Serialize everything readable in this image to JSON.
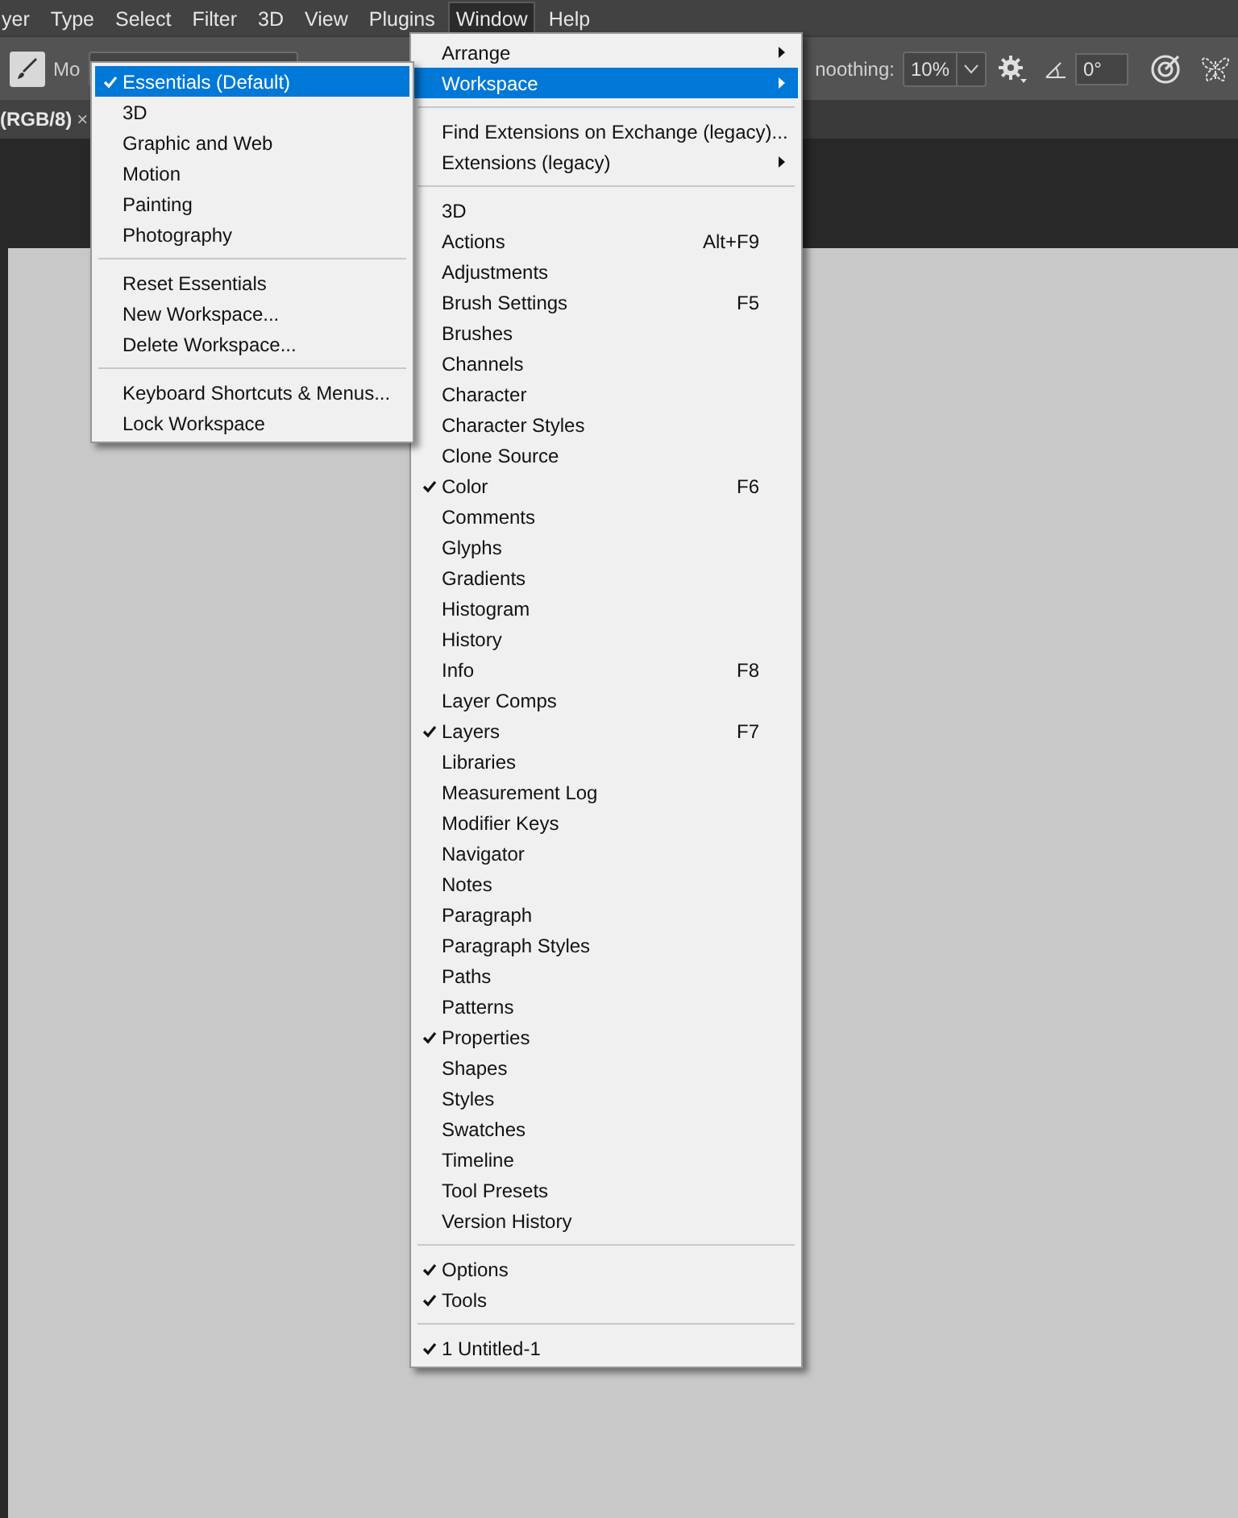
{
  "menubar": [
    {
      "label": "yer",
      "selected": false
    },
    {
      "label": "Type",
      "selected": false
    },
    {
      "label": "Select",
      "selected": false
    },
    {
      "label": "Filter",
      "selected": false
    },
    {
      "label": "3D",
      "selected": false
    },
    {
      "label": "View",
      "selected": false
    },
    {
      "label": "Plugins",
      "selected": false
    },
    {
      "label": "Window",
      "selected": true
    },
    {
      "label": "Help",
      "selected": false
    }
  ],
  "options_bar": {
    "mode_label": "Mo",
    "smoothing_label": "noothing:",
    "smoothing_value": "10%",
    "angle_value": "0°"
  },
  "document_tab": {
    "title": "(RGB/8)",
    "close": "×"
  },
  "window_menu": [
    {
      "kind": "item",
      "label": "Arrange",
      "checked": false,
      "selected": false,
      "submenu": true
    },
    {
      "kind": "item",
      "label": "Workspace",
      "checked": false,
      "selected": true,
      "submenu": true
    },
    {
      "kind": "separator"
    },
    {
      "kind": "item",
      "label": "Find Extensions on Exchange (legacy)...",
      "checked": false,
      "selected": false,
      "submenu": false
    },
    {
      "kind": "item",
      "label": "Extensions (legacy)",
      "checked": false,
      "selected": false,
      "submenu": true
    },
    {
      "kind": "separator"
    },
    {
      "kind": "item",
      "label": "3D",
      "checked": false,
      "selected": false,
      "submenu": false
    },
    {
      "kind": "item",
      "label": "Actions",
      "shortcut": "Alt+F9",
      "checked": false,
      "selected": false,
      "submenu": false
    },
    {
      "kind": "item",
      "label": "Adjustments",
      "checked": false,
      "selected": false,
      "submenu": false
    },
    {
      "kind": "item",
      "label": "Brush Settings",
      "shortcut": "F5",
      "checked": false,
      "selected": false,
      "submenu": false
    },
    {
      "kind": "item",
      "label": "Brushes",
      "checked": false,
      "selected": false,
      "submenu": false
    },
    {
      "kind": "item",
      "label": "Channels",
      "checked": false,
      "selected": false,
      "submenu": false
    },
    {
      "kind": "item",
      "label": "Character",
      "checked": false,
      "selected": false,
      "submenu": false
    },
    {
      "kind": "item",
      "label": "Character Styles",
      "checked": false,
      "selected": false,
      "submenu": false
    },
    {
      "kind": "item",
      "label": "Clone Source",
      "checked": false,
      "selected": false,
      "submenu": false
    },
    {
      "kind": "item",
      "label": "Color",
      "shortcut": "F6",
      "checked": true,
      "selected": false,
      "submenu": false
    },
    {
      "kind": "item",
      "label": "Comments",
      "checked": false,
      "selected": false,
      "submenu": false
    },
    {
      "kind": "item",
      "label": "Glyphs",
      "checked": false,
      "selected": false,
      "submenu": false
    },
    {
      "kind": "item",
      "label": "Gradients",
      "checked": false,
      "selected": false,
      "submenu": false
    },
    {
      "kind": "item",
      "label": "Histogram",
      "checked": false,
      "selected": false,
      "submenu": false
    },
    {
      "kind": "item",
      "label": "History",
      "checked": false,
      "selected": false,
      "submenu": false
    },
    {
      "kind": "item",
      "label": "Info",
      "shortcut": "F8",
      "checked": false,
      "selected": false,
      "submenu": false
    },
    {
      "kind": "item",
      "label": "Layer Comps",
      "checked": false,
      "selected": false,
      "submenu": false
    },
    {
      "kind": "item",
      "label": "Layers",
      "shortcut": "F7",
      "checked": true,
      "selected": false,
      "submenu": false
    },
    {
      "kind": "item",
      "label": "Libraries",
      "checked": false,
      "selected": false,
      "submenu": false
    },
    {
      "kind": "item",
      "label": "Measurement Log",
      "checked": false,
      "selected": false,
      "submenu": false
    },
    {
      "kind": "item",
      "label": "Modifier Keys",
      "checked": false,
      "selected": false,
      "submenu": false
    },
    {
      "kind": "item",
      "label": "Navigator",
      "checked": false,
      "selected": false,
      "submenu": false
    },
    {
      "kind": "item",
      "label": "Notes",
      "checked": false,
      "selected": false,
      "submenu": false
    },
    {
      "kind": "item",
      "label": "Paragraph",
      "checked": false,
      "selected": false,
      "submenu": false
    },
    {
      "kind": "item",
      "label": "Paragraph Styles",
      "checked": false,
      "selected": false,
      "submenu": false
    },
    {
      "kind": "item",
      "label": "Paths",
      "checked": false,
      "selected": false,
      "submenu": false
    },
    {
      "kind": "item",
      "label": "Patterns",
      "checked": false,
      "selected": false,
      "submenu": false
    },
    {
      "kind": "item",
      "label": "Properties",
      "checked": true,
      "selected": false,
      "submenu": false
    },
    {
      "kind": "item",
      "label": "Shapes",
      "checked": false,
      "selected": false,
      "submenu": false
    },
    {
      "kind": "item",
      "label": "Styles",
      "checked": false,
      "selected": false,
      "submenu": false
    },
    {
      "kind": "item",
      "label": "Swatches",
      "checked": false,
      "selected": false,
      "submenu": false
    },
    {
      "kind": "item",
      "label": "Timeline",
      "checked": false,
      "selected": false,
      "submenu": false
    },
    {
      "kind": "item",
      "label": "Tool Presets",
      "checked": false,
      "selected": false,
      "submenu": false
    },
    {
      "kind": "item",
      "label": "Version History",
      "checked": false,
      "selected": false,
      "submenu": false
    },
    {
      "kind": "separator"
    },
    {
      "kind": "item",
      "label": "Options",
      "checked": true,
      "selected": false,
      "submenu": false
    },
    {
      "kind": "item",
      "label": "Tools",
      "checked": true,
      "selected": false,
      "submenu": false
    },
    {
      "kind": "separator"
    },
    {
      "kind": "item",
      "label": "1 Untitled-1",
      "checked": true,
      "selected": false,
      "submenu": false
    }
  ],
  "workspace_menu": [
    {
      "kind": "item",
      "label": "Essentials (Default)",
      "checked": true,
      "selected": true
    },
    {
      "kind": "item",
      "label": "3D",
      "checked": false,
      "selected": false
    },
    {
      "kind": "item",
      "label": "Graphic and Web",
      "checked": false,
      "selected": false
    },
    {
      "kind": "item",
      "label": "Motion",
      "checked": false,
      "selected": false
    },
    {
      "kind": "item",
      "label": "Painting",
      "checked": false,
      "selected": false
    },
    {
      "kind": "item",
      "label": "Photography",
      "checked": false,
      "selected": false
    },
    {
      "kind": "separator"
    },
    {
      "kind": "item",
      "label": "Reset Essentials",
      "checked": false,
      "selected": false
    },
    {
      "kind": "item",
      "label": "New Workspace...",
      "checked": false,
      "selected": false
    },
    {
      "kind": "item",
      "label": "Delete Workspace...",
      "checked": false,
      "selected": false
    },
    {
      "kind": "separator"
    },
    {
      "kind": "item",
      "label": "Keyboard Shortcuts & Menus...",
      "checked": false,
      "selected": false
    },
    {
      "kind": "item",
      "label": "Lock Workspace",
      "checked": false,
      "selected": false
    }
  ]
}
